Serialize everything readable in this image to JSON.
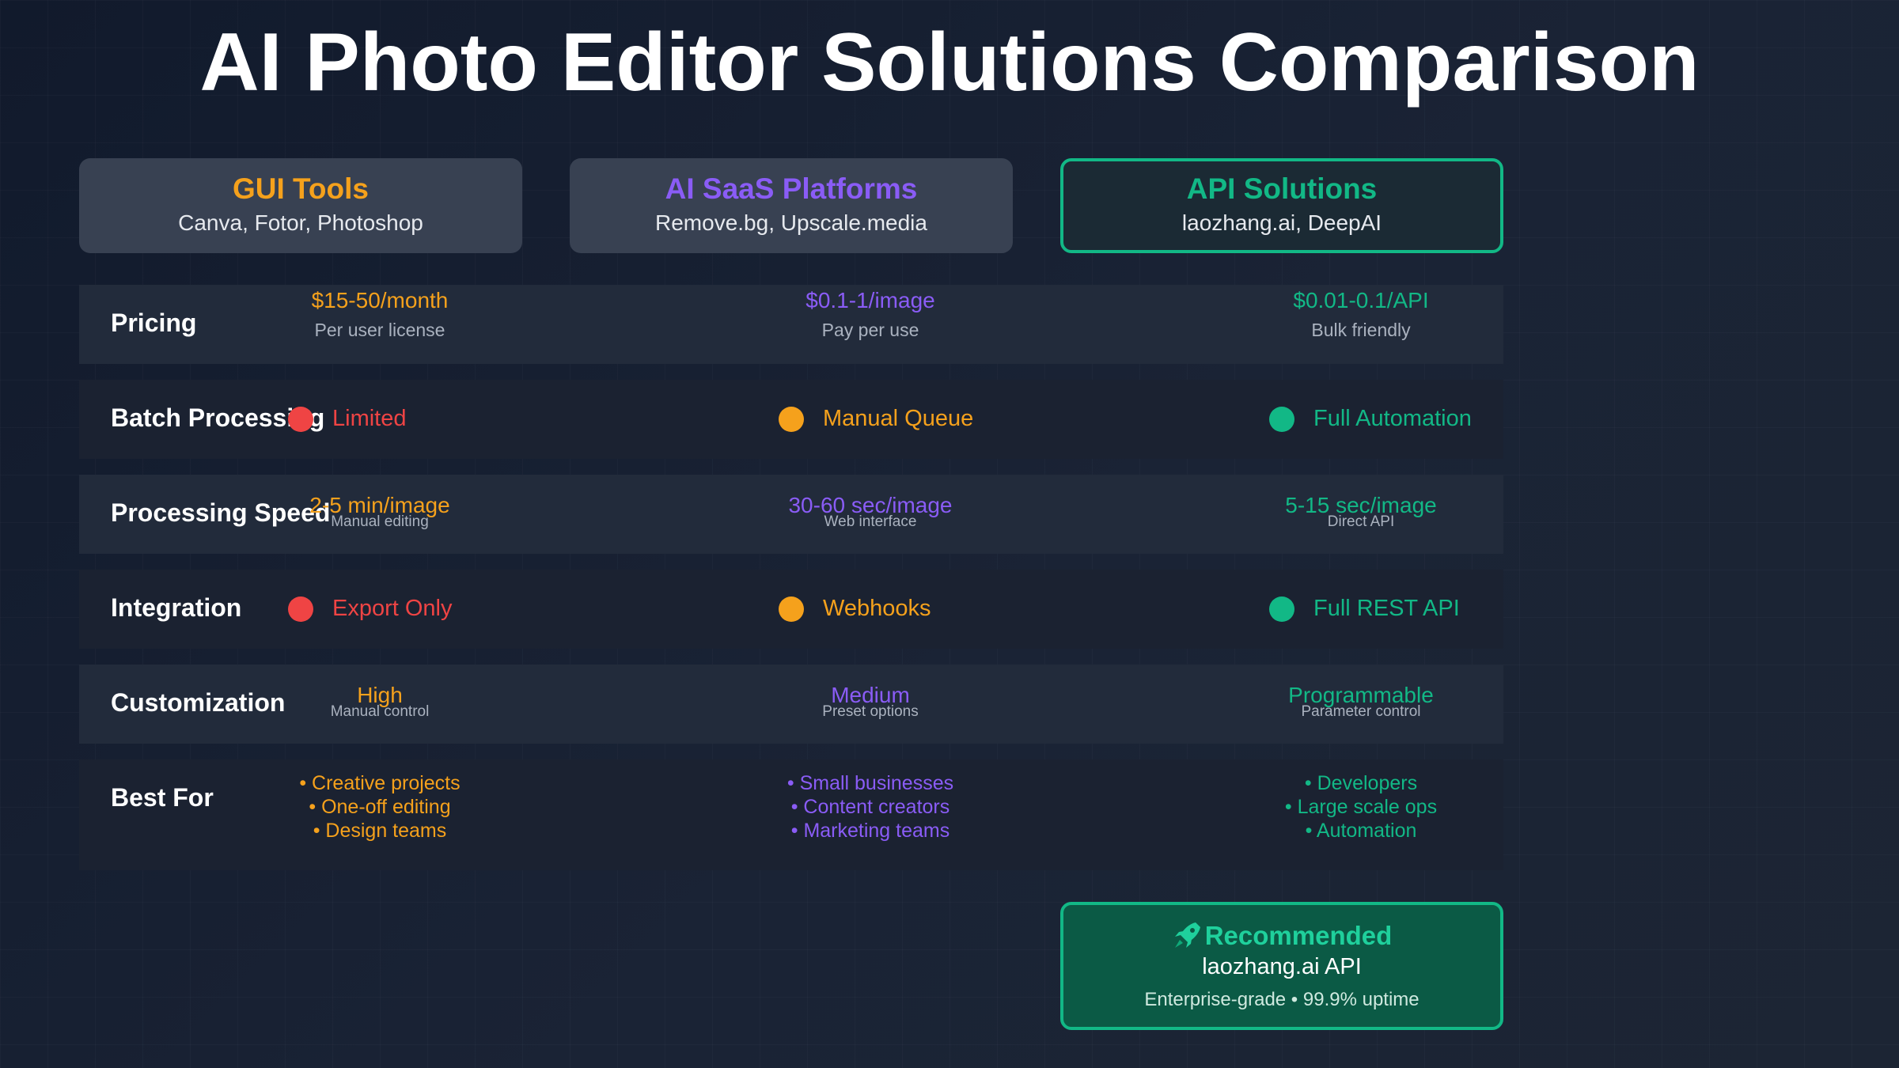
{
  "title": "AI Photo Editor Solutions Comparison",
  "colors": {
    "gui": "#f5a11c",
    "saas": "#8a5cf6",
    "api": "#12b886",
    "red": "#ef4444",
    "orange": "#f5a11c",
    "green": "#12b886"
  },
  "columns": [
    {
      "title": "GUI Tools",
      "subtitle": "Canva, Fotor, Photoshop"
    },
    {
      "title": "AI SaaS Platforms",
      "subtitle": "Remove.bg, Upscale.media"
    },
    {
      "title": "API Solutions",
      "subtitle": "laozhang.ai, DeepAI"
    }
  ],
  "rows": {
    "pricing": {
      "label": "Pricing",
      "cells": [
        {
          "value": "$15-50/month",
          "note": "Per user license"
        },
        {
          "value": "$0.1-1/image",
          "note": "Pay per use"
        },
        {
          "value": "$0.01-0.1/API",
          "note": "Bulk friendly"
        }
      ]
    },
    "batch": {
      "label": "Batch Processing",
      "cells": [
        {
          "status": "Limited",
          "level": "red"
        },
        {
          "status": "Manual Queue",
          "level": "orange"
        },
        {
          "status": "Full Automation",
          "level": "green"
        }
      ]
    },
    "speed": {
      "label": "Processing Speed",
      "cells": [
        {
          "value": "2-5 min/image",
          "note": "Manual editing"
        },
        {
          "value": "30-60 sec/image",
          "note": "Web interface"
        },
        {
          "value": "5-15 sec/image",
          "note": "Direct API"
        }
      ]
    },
    "integration": {
      "label": "Integration",
      "cells": [
        {
          "status": "Export Only",
          "level": "red"
        },
        {
          "status": "Webhooks",
          "level": "orange"
        },
        {
          "status": "Full REST API",
          "level": "green"
        }
      ]
    },
    "customization": {
      "label": "Customization",
      "cells": [
        {
          "value": "High",
          "note": "Manual control"
        },
        {
          "value": "Medium",
          "note": "Preset options"
        },
        {
          "value": "Programmable",
          "note": "Parameter control"
        }
      ]
    },
    "best_for": {
      "label": "Best For",
      "cells": [
        [
          "• Creative projects",
          "• One-off editing",
          "• Design teams"
        ],
        [
          "• Small businesses",
          "• Content creators",
          "• Marketing teams"
        ],
        [
          "• Developers",
          "• Large scale ops",
          "• Automation"
        ]
      ]
    }
  },
  "recommended": {
    "icon": "rocket-icon",
    "title": "Recommended",
    "name": "laozhang.ai API",
    "note": "Enterprise-grade • 99.9% uptime"
  }
}
